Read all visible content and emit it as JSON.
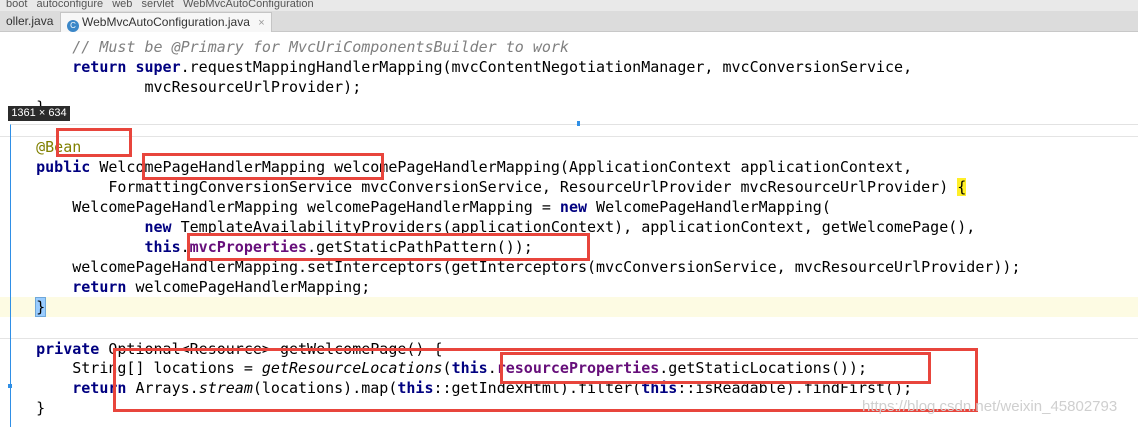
{
  "breadcrumb": [
    "boot",
    "autoconfigure",
    "web",
    "servlet",
    "WebMvcAutoConfiguration"
  ],
  "tabs": [
    {
      "label": "oller.java",
      "active": false
    },
    {
      "label": "WebMvcAutoConfiguration.java",
      "active": true
    }
  ],
  "tab_close_glyph": "×",
  "snapshot_size": "1361 × 634",
  "watermark": "https://blog.csdn.net/weixin_45802793",
  "code": {
    "l1_comment": "// Must be @Primary for MvcUriComponentsBuilder to work",
    "l2_return": "return ",
    "l2_super": "super",
    "l2_rest": ".requestMappingHandlerMapping(mvcContentNegotiationManager, mvcConversionService,",
    "l3": "mvcResourceUrlProvider);",
    "l4": "}",
    "l5_annotation": "@Bean",
    "l6_public": "public ",
    "l6_type": "WelcomePageHandlerMapping",
    "l6_rest": " welcomePageHandlerMapping(ApplicationContext applicationContext,",
    "l7": "FormattingConversionService mvcConversionService, ResourceUrlProvider mvcResourceUrlProvider) ",
    "l7_brace": "{",
    "l8_a": "WelcomePageHandlerMapping welcomePageHandlerMapping = ",
    "l8_new": "new",
    "l8_b": " WelcomePageHandlerMapping(",
    "l9_new": "new",
    "l9_rest": " TemplateAvailabilityProviders(applicationContext), applicationContext, getWelcomePage(),",
    "l10_this": "this",
    "l10_dot": ".",
    "l10_field": "mvcProperties",
    "l10_rest": ".getStaticPathPattern());",
    "l11": "welcomePageHandlerMapping.setInterceptors(getInterceptors(mvcConversionService, mvcResourceUrlProvider));",
    "l12_return": "return",
    "l12_rest": " welcomePageHandlerMapping;",
    "l13_brace": "}",
    "l14_private": "private",
    "l14_rest": " Optional<Resource> getWelcomePage() {",
    "l15_a": "String[] locations = ",
    "l15_method": "getResourceLocations",
    "l15_paren": "(",
    "l15_this": "this",
    "l15_dot": ".",
    "l15_field": "resourceProperties",
    "l15_rest": ".getStaticLocations());",
    "l16_return": "return",
    "l16_a": " Arrays.",
    "l16_stream": "stream",
    "l16_b": "(locations).map(",
    "l16_this": "this",
    "l16_c": "::getIndexHtml).filter(",
    "l16_this2": "this",
    "l16_d": "::isReadable).findFirst();",
    "l17": "}"
  },
  "colors": {
    "keyword": "#000080",
    "comment": "#808080",
    "annotation": "#808000",
    "field": "#660e7a",
    "highlight_box": "#e8453c",
    "selection_frame": "#2f8fe6"
  }
}
